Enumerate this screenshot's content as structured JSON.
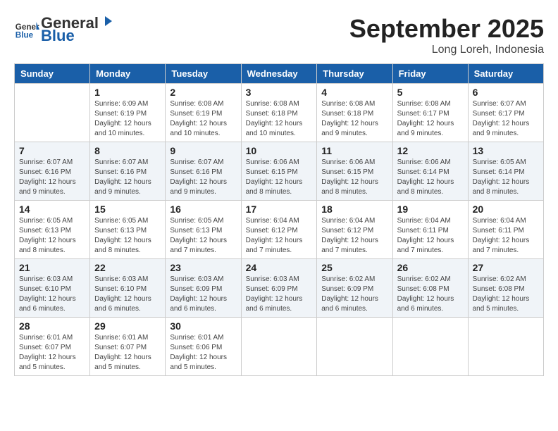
{
  "header": {
    "logo_general": "General",
    "logo_blue": "Blue",
    "month": "September 2025",
    "location": "Long Loreh, Indonesia"
  },
  "weekdays": [
    "Sunday",
    "Monday",
    "Tuesday",
    "Wednesday",
    "Thursday",
    "Friday",
    "Saturday"
  ],
  "weeks": [
    [
      {
        "day": "",
        "info": ""
      },
      {
        "day": "1",
        "info": "Sunrise: 6:09 AM\nSunset: 6:19 PM\nDaylight: 12 hours\nand 10 minutes."
      },
      {
        "day": "2",
        "info": "Sunrise: 6:08 AM\nSunset: 6:19 PM\nDaylight: 12 hours\nand 10 minutes."
      },
      {
        "day": "3",
        "info": "Sunrise: 6:08 AM\nSunset: 6:18 PM\nDaylight: 12 hours\nand 10 minutes."
      },
      {
        "day": "4",
        "info": "Sunrise: 6:08 AM\nSunset: 6:18 PM\nDaylight: 12 hours\nand 9 minutes."
      },
      {
        "day": "5",
        "info": "Sunrise: 6:08 AM\nSunset: 6:17 PM\nDaylight: 12 hours\nand 9 minutes."
      },
      {
        "day": "6",
        "info": "Sunrise: 6:07 AM\nSunset: 6:17 PM\nDaylight: 12 hours\nand 9 minutes."
      }
    ],
    [
      {
        "day": "7",
        "info": "Sunrise: 6:07 AM\nSunset: 6:16 PM\nDaylight: 12 hours\nand 9 minutes."
      },
      {
        "day": "8",
        "info": "Sunrise: 6:07 AM\nSunset: 6:16 PM\nDaylight: 12 hours\nand 9 minutes."
      },
      {
        "day": "9",
        "info": "Sunrise: 6:07 AM\nSunset: 6:16 PM\nDaylight: 12 hours\nand 9 minutes."
      },
      {
        "day": "10",
        "info": "Sunrise: 6:06 AM\nSunset: 6:15 PM\nDaylight: 12 hours\nand 8 minutes."
      },
      {
        "day": "11",
        "info": "Sunrise: 6:06 AM\nSunset: 6:15 PM\nDaylight: 12 hours\nand 8 minutes."
      },
      {
        "day": "12",
        "info": "Sunrise: 6:06 AM\nSunset: 6:14 PM\nDaylight: 12 hours\nand 8 minutes."
      },
      {
        "day": "13",
        "info": "Sunrise: 6:05 AM\nSunset: 6:14 PM\nDaylight: 12 hours\nand 8 minutes."
      }
    ],
    [
      {
        "day": "14",
        "info": "Sunrise: 6:05 AM\nSunset: 6:13 PM\nDaylight: 12 hours\nand 8 minutes."
      },
      {
        "day": "15",
        "info": "Sunrise: 6:05 AM\nSunset: 6:13 PM\nDaylight: 12 hours\nand 8 minutes."
      },
      {
        "day": "16",
        "info": "Sunrise: 6:05 AM\nSunset: 6:13 PM\nDaylight: 12 hours\nand 7 minutes."
      },
      {
        "day": "17",
        "info": "Sunrise: 6:04 AM\nSunset: 6:12 PM\nDaylight: 12 hours\nand 7 minutes."
      },
      {
        "day": "18",
        "info": "Sunrise: 6:04 AM\nSunset: 6:12 PM\nDaylight: 12 hours\nand 7 minutes."
      },
      {
        "day": "19",
        "info": "Sunrise: 6:04 AM\nSunset: 6:11 PM\nDaylight: 12 hours\nand 7 minutes."
      },
      {
        "day": "20",
        "info": "Sunrise: 6:04 AM\nSunset: 6:11 PM\nDaylight: 12 hours\nand 7 minutes."
      }
    ],
    [
      {
        "day": "21",
        "info": "Sunrise: 6:03 AM\nSunset: 6:10 PM\nDaylight: 12 hours\nand 6 minutes."
      },
      {
        "day": "22",
        "info": "Sunrise: 6:03 AM\nSunset: 6:10 PM\nDaylight: 12 hours\nand 6 minutes."
      },
      {
        "day": "23",
        "info": "Sunrise: 6:03 AM\nSunset: 6:09 PM\nDaylight: 12 hours\nand 6 minutes."
      },
      {
        "day": "24",
        "info": "Sunrise: 6:03 AM\nSunset: 6:09 PM\nDaylight: 12 hours\nand 6 minutes."
      },
      {
        "day": "25",
        "info": "Sunrise: 6:02 AM\nSunset: 6:09 PM\nDaylight: 12 hours\nand 6 minutes."
      },
      {
        "day": "26",
        "info": "Sunrise: 6:02 AM\nSunset: 6:08 PM\nDaylight: 12 hours\nand 6 minutes."
      },
      {
        "day": "27",
        "info": "Sunrise: 6:02 AM\nSunset: 6:08 PM\nDaylight: 12 hours\nand 5 minutes."
      }
    ],
    [
      {
        "day": "28",
        "info": "Sunrise: 6:01 AM\nSunset: 6:07 PM\nDaylight: 12 hours\nand 5 minutes."
      },
      {
        "day": "29",
        "info": "Sunrise: 6:01 AM\nSunset: 6:07 PM\nDaylight: 12 hours\nand 5 minutes."
      },
      {
        "day": "30",
        "info": "Sunrise: 6:01 AM\nSunset: 6:06 PM\nDaylight: 12 hours\nand 5 minutes."
      },
      {
        "day": "",
        "info": ""
      },
      {
        "day": "",
        "info": ""
      },
      {
        "day": "",
        "info": ""
      },
      {
        "day": "",
        "info": ""
      }
    ]
  ]
}
